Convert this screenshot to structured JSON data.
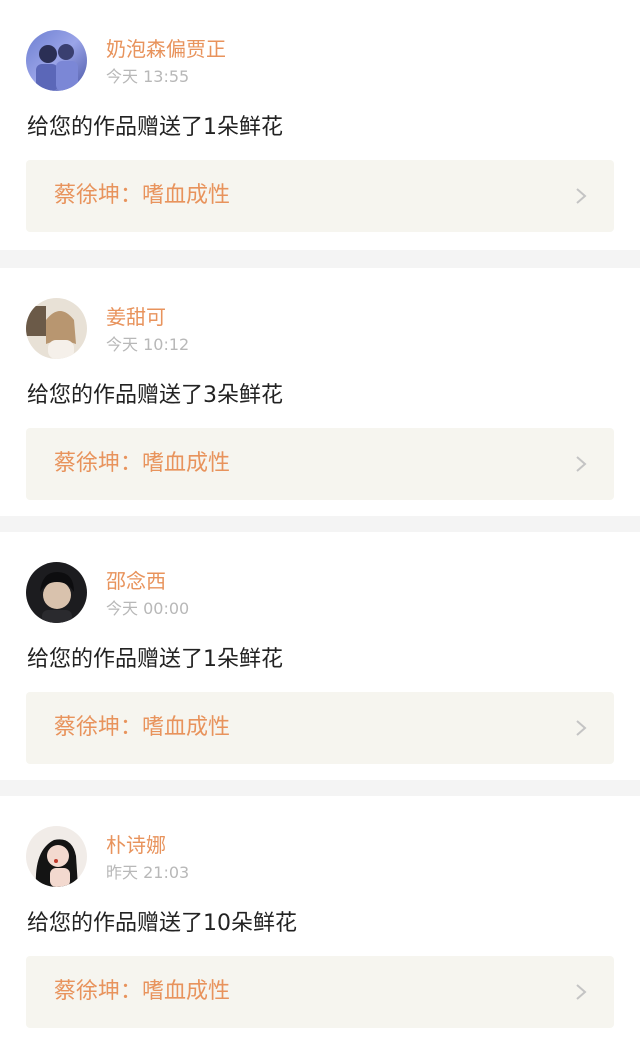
{
  "feed": {
    "items": [
      {
        "username": "奶泡森偏贾正",
        "time": "今天 13:55",
        "message": "给您的作品赠送了1朵鲜花",
        "work_title": "蔡徐坤：嗜血成性"
      },
      {
        "username": "姜甜可",
        "time": "今天 10:12",
        "message": "给您的作品赠送了3朵鲜花",
        "work_title": "蔡徐坤：嗜血成性"
      },
      {
        "username": "邵念西",
        "time": "今天 00:00",
        "message": "给您的作品赠送了1朵鲜花",
        "work_title": "蔡徐坤：嗜血成性"
      },
      {
        "username": "朴诗娜",
        "time": "昨天 21:03",
        "message": "给您的作品赠送了10朵鲜花",
        "work_title": "蔡徐坤：嗜血成性"
      }
    ]
  },
  "icons": {
    "chevron": "chevron-right-icon"
  },
  "colors": {
    "accent": "#e8935c",
    "muted": "#b8b8b8",
    "card_bg": "#ffffff",
    "link_bg": "#f6f5ef",
    "separator": "#f4f4f4"
  }
}
